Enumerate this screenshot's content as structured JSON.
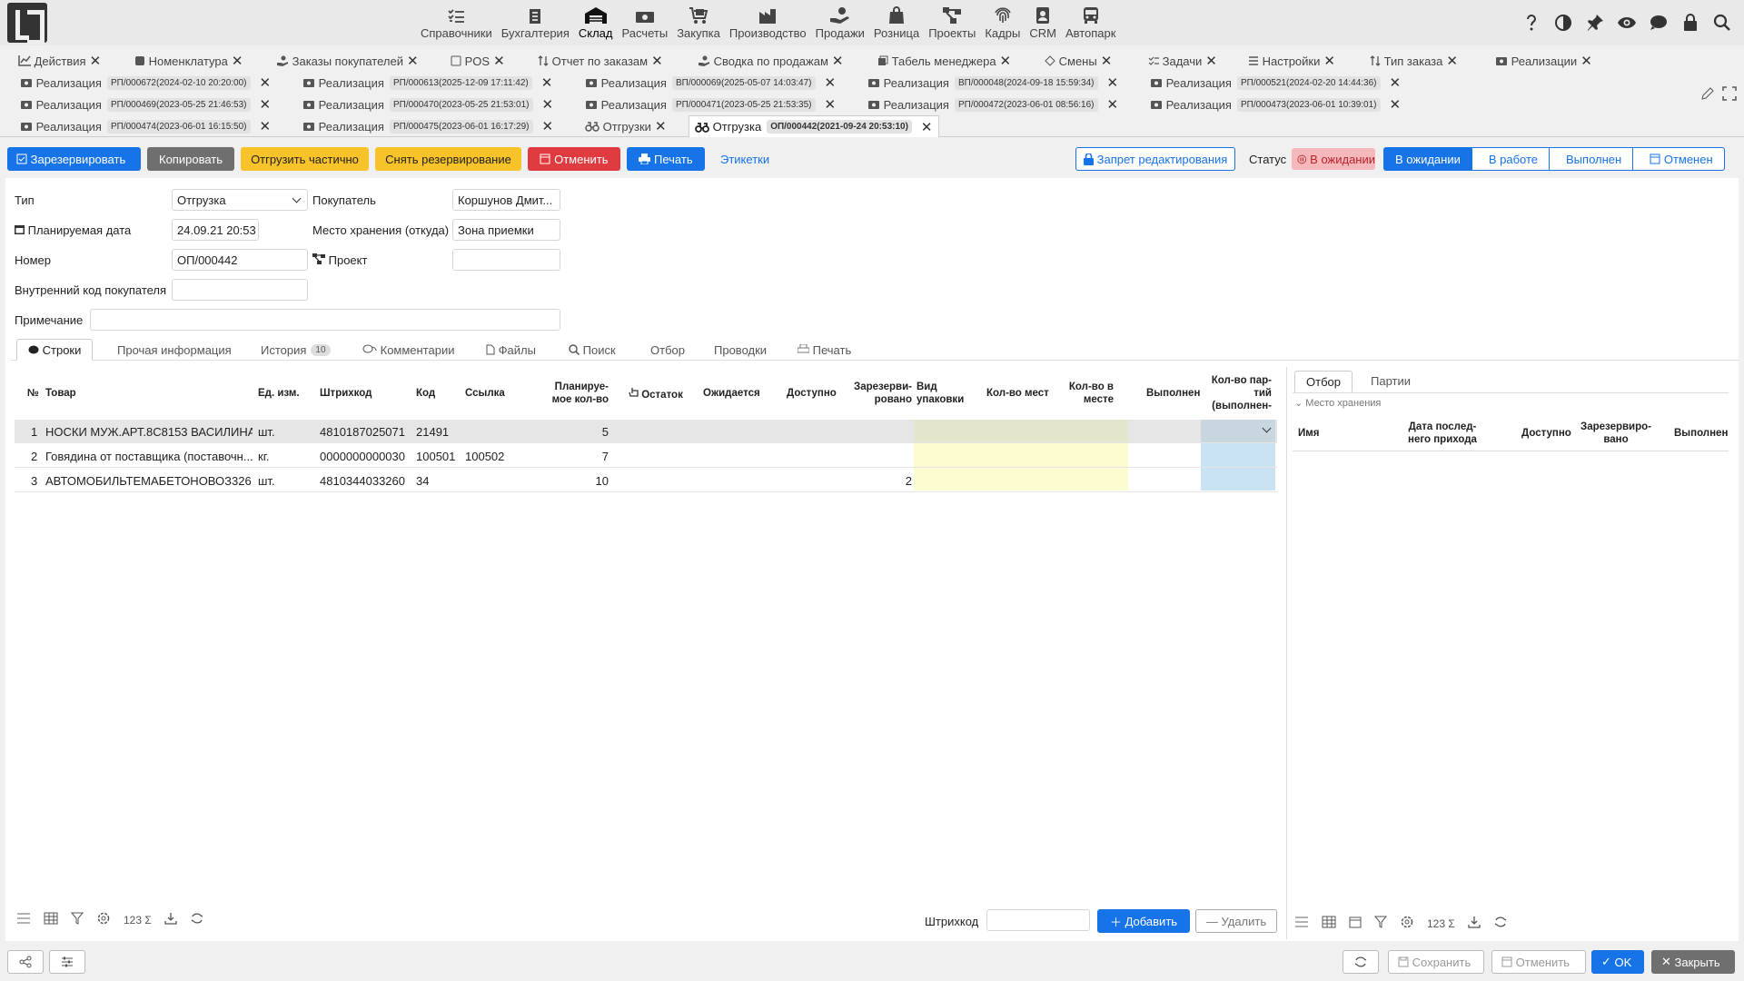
{
  "nav": {
    "modules": [
      {
        "label": "Справочники",
        "icon": "list-check-icon"
      },
      {
        "label": "Бухгалтерия",
        "icon": "ledger-icon"
      },
      {
        "label": "Склад",
        "icon": "warehouse-icon"
      },
      {
        "label": "Расчеты",
        "icon": "money-icon"
      },
      {
        "label": "Закупка",
        "icon": "cart-icon"
      },
      {
        "label": "Производство",
        "icon": "factory-icon"
      },
      {
        "label": "Продажи",
        "icon": "hand-coin-icon"
      },
      {
        "label": "Розница",
        "icon": "shopping-bag-icon"
      },
      {
        "label": "Проекты",
        "icon": "project-tree-icon"
      },
      {
        "label": "Кадры",
        "icon": "fingerprint-icon"
      },
      {
        "label": "CRM",
        "icon": "contact-icon"
      },
      {
        "label": "Автопарк",
        "icon": "bus-icon"
      }
    ],
    "active_module": "Склад"
  },
  "tabs": {
    "row1": [
      {
        "label": "Действия",
        "icon": "chart-icon"
      },
      {
        "label": "Номенклатура",
        "icon": "tag-icon"
      },
      {
        "label": "Заказы покупателей",
        "icon": "hand-icon"
      },
      {
        "label": "POS",
        "icon": "pos-icon"
      },
      {
        "label": "Отчет по заказам",
        "icon": "sort-icon"
      },
      {
        "label": "Сводка по продажам",
        "icon": "hand-icon"
      },
      {
        "label": "Табель менеджера",
        "icon": "copy-icon"
      },
      {
        "label": "Смены",
        "icon": "shift-icon"
      },
      {
        "label": "Задачи",
        "icon": "tasks-icon"
      },
      {
        "label": "Настройки",
        "icon": "settings-icon"
      },
      {
        "label": "Тип заказа",
        "icon": "sort-icon"
      },
      {
        "label": "Реализации",
        "icon": "money-icon"
      }
    ],
    "row2": [
      {
        "label": "Реализация",
        "pill": "РП/000672(2024-02-10 20:20:00)"
      },
      {
        "label": "Реализация",
        "pill": "РП/000613(2025-12-09 17:11:42)"
      },
      {
        "label": "Реализация",
        "pill": "ВП/000069(2025-05-07 14:03:47)"
      },
      {
        "label": "Реализация",
        "pill": "ВП/000048(2024-09-18 15:59:34)"
      },
      {
        "label": "Реализация",
        "pill": "РП/000521(2024-02-20 14:44:36)"
      }
    ],
    "row3": [
      {
        "label": "Реализация",
        "pill": "РП/000469(2023-05-25 21:46:53)"
      },
      {
        "label": "Реализация",
        "pill": "РП/000470(2023-05-25 21:53:01)"
      },
      {
        "label": "Реализация",
        "pill": "РП/000471(2023-05-25 21:53:35)"
      },
      {
        "label": "Реализация",
        "pill": "РП/000472(2023-06-01 08:56:16)"
      },
      {
        "label": "Реализация",
        "pill": "РП/000473(2023-06-01 10:39:01)"
      }
    ],
    "row4": [
      {
        "label": "Реализация",
        "pill": "РП/000474(2023-06-01 16:15:50)"
      },
      {
        "label": "Реализация",
        "pill": "РП/000475(2023-06-01 16:17:29)"
      },
      {
        "label": "Отгрузки",
        "pill": ""
      }
    ],
    "active": {
      "label": "Отгрузка",
      "pill": "ОП/000442(2021-09-24 20:53:10)"
    }
  },
  "toolbar": {
    "reserve": "Зарезервировать",
    "copy": "Копировать",
    "ship_partial": "Отгрузить частично",
    "unreserve": "Снять резервирование",
    "cancel": "Отменить",
    "print": "Печать",
    "labels": "Этикетки",
    "lock": "Запрет редактирования",
    "status_label": "Статус",
    "status_value": "В ожидании"
  },
  "workflow": [
    "В ожидании",
    "В работе",
    "Выполнен",
    "Отменен"
  ],
  "form": {
    "type_label": "Тип",
    "type_value": "Отгрузка",
    "date_label": "Планируемая дата",
    "date_value": "24.09.21 20:53",
    "number_label": "Номер",
    "number_value": "ОП/000442",
    "internal_code_label": "Внутренний код покупателя",
    "internal_code_value": "",
    "note_label": "Примечание",
    "note_value": "",
    "buyer_label": "Покупатель",
    "buyer_value": "Коршунов Дмит...",
    "storage_label": "Место хранения (откуда)",
    "storage_value": "Зона приемки",
    "project_label": "Проект",
    "project_value": ""
  },
  "inner_tabs": [
    {
      "label": "Строки"
    },
    {
      "label": "Прочая информация"
    },
    {
      "label": "История",
      "count": "10"
    },
    {
      "label": "Комментарии"
    },
    {
      "label": "Файлы"
    },
    {
      "label": "Поиск"
    },
    {
      "label": "Отбор"
    },
    {
      "label": "Проводки"
    },
    {
      "label": "Печать"
    }
  ],
  "grid": {
    "headers": {
      "num": "№",
      "product": "Товар",
      "unit": "Ед. изм.",
      "barcode": "Штрихкод",
      "code": "Код",
      "link": "Ссылка",
      "planned_a": "Планируе-",
      "planned_b": "мое кол-во",
      "stock": "Остаток",
      "expected": "Ожидается",
      "available": "Доступно",
      "reserved_a": "Зарезерви-",
      "reserved_b": "ровано",
      "pack_a": "Вид",
      "pack_b": "упаковки",
      "places": "Кол-во мест",
      "inplace_a": "Кол-во в",
      "inplace_b": "месте",
      "done": "Выполнен",
      "batches_a": "Кол-во пар-",
      "batches_b": "тий",
      "batches_c": "(выполнен-"
    },
    "rows": [
      {
        "num": "1",
        "product": "НОСКИ МУЖ.АРТ.8С8153 ВАСИЛИНА",
        "unit": "шт.",
        "barcode": "4810187025071",
        "code": "21491",
        "link": "",
        "planned": "5",
        "reserved": ""
      },
      {
        "num": "2",
        "product": "Говядина от поставщика (поставочн...",
        "unit": "кг.",
        "barcode": "0000000000030",
        "code": "100501",
        "link": "100502",
        "planned": "7",
        "reserved": ""
      },
      {
        "num": "3",
        "product": "АВТОМОБИЛЬТЕМАБЕТОНОВОЗ326...",
        "unit": "шт.",
        "barcode": "4810344033260",
        "code": "34",
        "link": "",
        "planned": "10",
        "reserved": "2"
      }
    ],
    "barcode_label": "Штрихкод",
    "add": "Добавить",
    "remove": "Удалить",
    "sum_label": "123 Σ"
  },
  "right_panel": {
    "tabs": [
      "Отбор",
      "Партии"
    ],
    "group": "Место хранения",
    "headers": {
      "name": "Имя",
      "date_a": "Дата послед-",
      "date_b": "него прихода",
      "available": "Доступно",
      "reserved_a": "Зарезервиро-",
      "reserved_b": "вано",
      "done": "Выполнен"
    }
  },
  "footer": {
    "save": "Сохранить",
    "cancel": "Отменить",
    "ok": "OK",
    "close": "Закрыть"
  },
  "colors": {
    "primary": "#1773e8",
    "yellow": "#f7c328",
    "red": "#df3b40",
    "grey": "#6f6f6f"
  }
}
